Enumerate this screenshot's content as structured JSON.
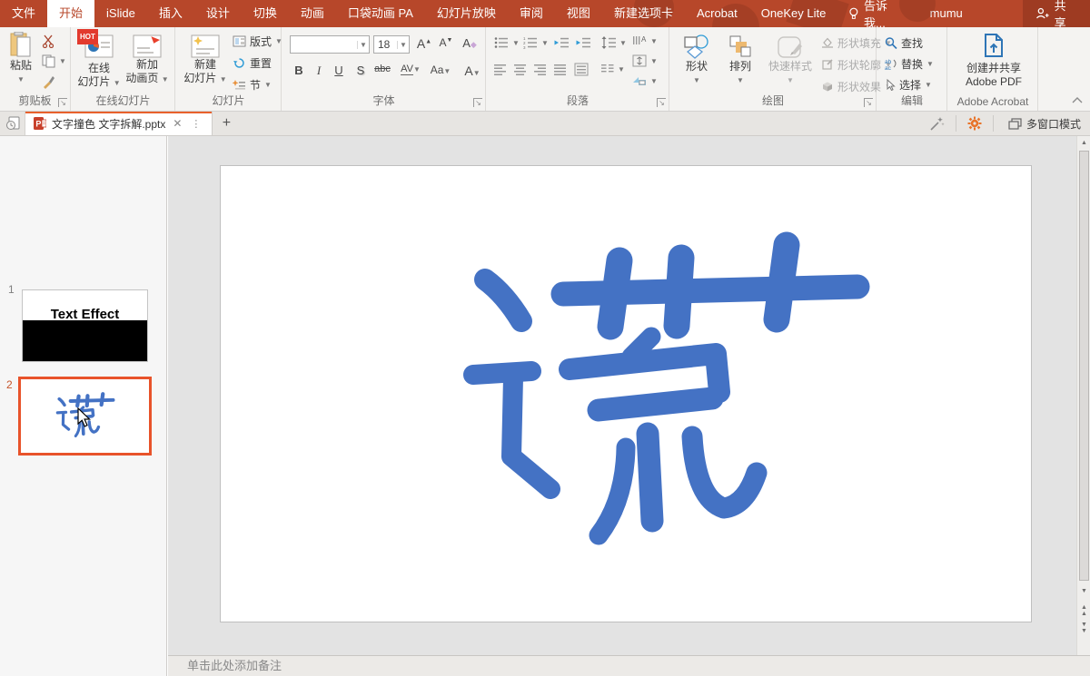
{
  "titlebar": {
    "tabs": [
      "文件",
      "开始",
      "iSlide",
      "插入",
      "设计",
      "切换",
      "动画",
      "口袋动画 PA",
      "幻灯片放映",
      "审阅",
      "视图",
      "新建选项卡",
      "Acrobat",
      "OneKey Lite"
    ],
    "active_tab": "开始",
    "tell_me": "告诉我...",
    "user_name": "mumu mumuji...",
    "share_label": "共享"
  },
  "ribbon": {
    "clipboard": {
      "label": "剪贴板",
      "paste": "粘贴"
    },
    "online_slides": {
      "label": "在线幻灯片",
      "hot_badge": "HOT",
      "online_l1": "在线",
      "online_l2": "幻灯片",
      "newanim_l1": "新加",
      "newanim_l2": "动画页"
    },
    "slides": {
      "label": "幻灯片",
      "new_l1": "新建",
      "new_l2": "幻灯片",
      "layout": "版式",
      "reset": "重置",
      "section": "节"
    },
    "font": {
      "label": "字体",
      "name_value": "",
      "size_value": "18",
      "bold": "B",
      "italic": "I",
      "underline": "U",
      "strike": "S",
      "abc": "abc",
      "av": "AV",
      "aa": "Aa",
      "color_a": "A",
      "grow_a": "A",
      "shrink_a": "A",
      "clear_a": "A"
    },
    "paragraph": {
      "label": "段落"
    },
    "drawing": {
      "label": "绘图",
      "shapes": "形状",
      "arrange": "排列",
      "quick_styles": "快速样式",
      "shape_fill": "形状填充",
      "shape_outline": "形状轮廓",
      "shape_effects": "形状效果"
    },
    "editing": {
      "label": "编辑",
      "find": "查找",
      "replace": "替换",
      "select": "选择"
    },
    "acrobat": {
      "label": "Adobe Acrobat",
      "create_l1": "创建并共享",
      "create_l2": "Adobe PDF"
    }
  },
  "doc_tabbar": {
    "active_doc": "文字撞色 文字拆解.pptx",
    "multi_window": "多窗口模式"
  },
  "slides_panel": {
    "slide1": {
      "number": "1",
      "title": "Text Effect"
    },
    "slide2": {
      "number": "2",
      "character": "谎"
    }
  },
  "canvas": {
    "character": "谎",
    "char_color": "#4472C4"
  },
  "notes": {
    "placeholder": "单击此处添加备注"
  },
  "colors": {
    "titlebar_red": "#B7472A",
    "accent_orange": "#E8612C",
    "selection_border": "#E8532A",
    "char_blue": "#4472C4"
  }
}
